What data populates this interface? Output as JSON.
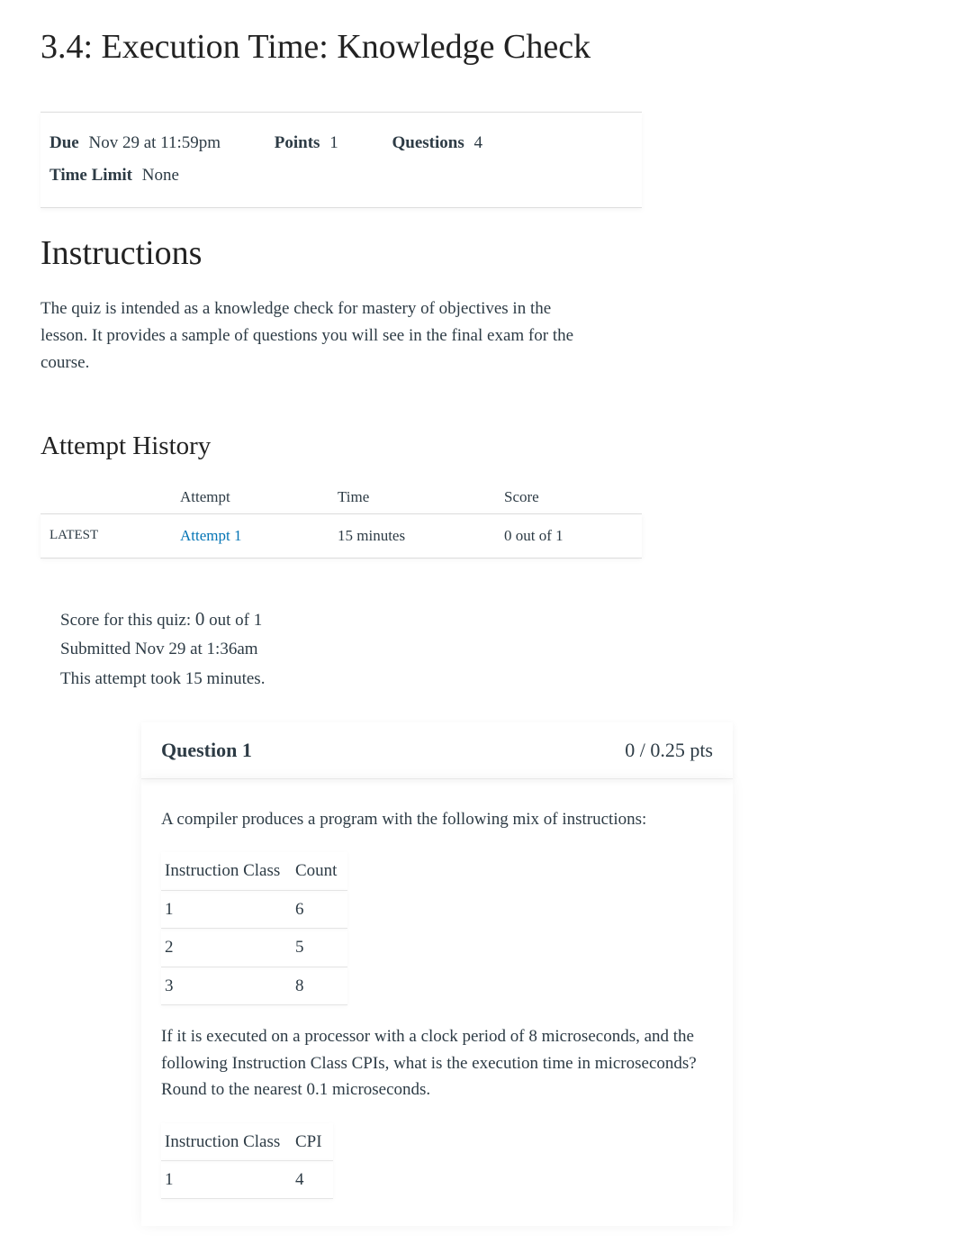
{
  "title": "3.4: Execution Time: Knowledge Check",
  "meta": {
    "due_label": "Due",
    "due_value": "Nov 29 at 11:59pm",
    "points_label": "Points",
    "points_value": "1",
    "questions_label": "Questions",
    "questions_value": "4",
    "time_limit_label": "Time Limit",
    "time_limit_value": "None"
  },
  "instructions": {
    "heading": "Instructions",
    "body": "The quiz is intended as a knowledge check for mastery of objectives in the lesson.    It provides a sample of questions you will see in the final exam for the course."
  },
  "attempt_history": {
    "heading": "Attempt History",
    "cols": {
      "attempt": "Attempt",
      "time": "Time",
      "score": "Score"
    },
    "rows": [
      {
        "status": "LATEST",
        "attempt": "Attempt 1",
        "time": "15 minutes",
        "score": "0 out of 1"
      }
    ]
  },
  "score_summary": {
    "line1_prefix": "Score for this quiz: ",
    "line1_score": "0",
    "line1_suffix": " out of 1",
    "line2": "Submitted Nov 29 at 1:36am",
    "line3": "This attempt took 15 minutes."
  },
  "question": {
    "label": "Question 1",
    "points": "0 / 0.25 pts",
    "prompt1": "A compiler produces a program with the following mix of instructions:",
    "count_table": {
      "h1": "Instruction Class",
      "h2": "Count",
      "rows": [
        {
          "c1": "1",
          "c2": "6"
        },
        {
          "c1": "2",
          "c2": "5"
        },
        {
          "c1": "3",
          "c2": "8"
        }
      ]
    },
    "prompt2": "If it is executed on a processor with a clock period of 8 microseconds, and the following Instruction Class CPIs, what is the execution time in microseconds?     Round to the nearest 0.1 microseconds.",
    "cpi_table": {
      "h1": "Instruction Class",
      "h2": "CPI",
      "rows": [
        {
          "c1": "1",
          "c2": "4"
        }
      ]
    }
  }
}
